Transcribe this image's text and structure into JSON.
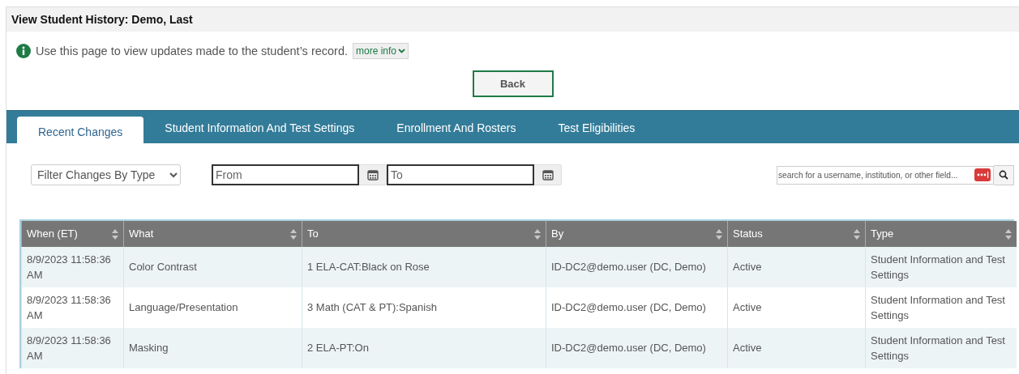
{
  "page": {
    "title": "View Student History: Demo, Last",
    "info": "Use this page to view updates made to the student’s record.",
    "more_info": "more info",
    "back": "Back"
  },
  "tabs": [
    {
      "label": "Recent Changes",
      "selected": true
    },
    {
      "label": "Student Information And Test Settings",
      "selected": false
    },
    {
      "label": "Enrollment And Rosters",
      "selected": false
    },
    {
      "label": "Test Eligibilities",
      "selected": false
    }
  ],
  "filters": {
    "type_select": "Filter Changes By Type",
    "from_placeholder": "From",
    "to_placeholder": "To",
    "search_placeholder": "search for a username, institution, or other field..."
  },
  "table": {
    "columns": [
      "When (ET)",
      "What",
      "To",
      "By",
      "Status",
      "Type"
    ],
    "rows": [
      [
        "8/9/2023 11:58:36 AM",
        "Color Contrast",
        "1 ELA-CAT:Black on Rose",
        "ID-DC2@demo.user (DC, Demo)",
        "Active",
        "Student Information and Test Settings"
      ],
      [
        "8/9/2023 11:58:36 AM",
        "Language/Presentation",
        "3 Math (CAT & PT):Spanish",
        "ID-DC2@demo.user (DC, Demo)",
        "Active",
        "Student Information and Test Settings"
      ],
      [
        "8/9/2023 11:58:36 AM",
        "Masking",
        "2 ELA-PT:On",
        "ID-DC2@demo.user (DC, Demo)",
        "Active",
        "Student Information and Test Settings"
      ]
    ]
  }
}
